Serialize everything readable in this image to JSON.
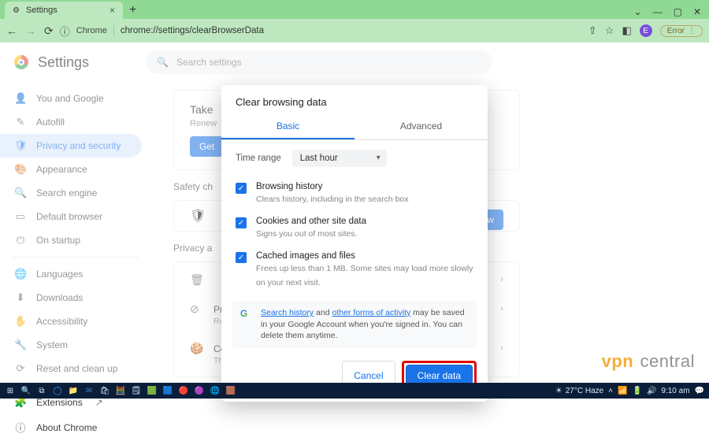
{
  "titlebar": {
    "tab_title": "Settings",
    "win_min": "—",
    "win_max": "▢",
    "win_close": "✕",
    "win_down": "⌄"
  },
  "urlbar": {
    "back": "←",
    "forward": "→",
    "reload": "⟳",
    "protocol_icon": "ⓘ",
    "chip": "Chrome",
    "url": "chrome://settings/clearBrowserData",
    "share": "⇧",
    "star": "☆",
    "ext": "◧",
    "avatar": "E",
    "error_label": "Error",
    "menu": "⋮"
  },
  "settings": {
    "title": "Settings",
    "search_placeholder": "Search settings",
    "sidebar": [
      {
        "icon": "👤",
        "label": "You and Google"
      },
      {
        "icon": "✎",
        "label": "Autofill"
      },
      {
        "icon": "🛡",
        "label": "Privacy and security"
      },
      {
        "icon": "🎨",
        "label": "Appearance"
      },
      {
        "icon": "🔍",
        "label": "Search engine"
      },
      {
        "icon": "▭",
        "label": "Default browser"
      },
      {
        "icon": "⏻",
        "label": "On startup"
      }
    ],
    "sidebar2": [
      {
        "icon": "🌐",
        "label": "Languages"
      },
      {
        "icon": "⬇",
        "label": "Downloads"
      },
      {
        "icon": "✋",
        "label": "Accessibility"
      },
      {
        "icon": "🔧",
        "label": "System"
      },
      {
        "icon": "⟳",
        "label": "Reset and clean up"
      }
    ],
    "sidebar3": [
      {
        "icon": "🧩",
        "label": "Extensions"
      },
      {
        "icon": "ⓘ",
        "label": "About Chrome"
      }
    ],
    "promo": {
      "title": "Take",
      "sub": "Renew",
      "cta": "Get"
    },
    "safety_label": "Safety ch",
    "safety_btn": "Check now",
    "privacy_label": "Privacy a",
    "rows": [
      {
        "icon": "🗑",
        "title": "",
        "sub": ""
      },
      {
        "icon": "⊘",
        "title": "Privacy guide",
        "sub": "Review key privacy and security controls"
      },
      {
        "icon": "🍪",
        "title": "Cookies and other site data",
        "sub": "Third-party cookies are blocked in Incognito mode"
      }
    ]
  },
  "modal": {
    "title": "Clear browsing data",
    "tab_basic": "Basic",
    "tab_advanced": "Advanced",
    "time_range_label": "Time range",
    "time_range_value": "Last hour",
    "checks": [
      {
        "title": "Browsing history",
        "sub": "Clears history, including in the search box"
      },
      {
        "title": "Cookies and other site data",
        "sub": "Signs you out of most sites."
      },
      {
        "title": "Cached images and files",
        "sub": "Frees up less than 1 MB. Some sites may load more slowly on your next visit."
      }
    ],
    "info_pre": "",
    "info_link1": "Search history",
    "info_mid": " and ",
    "info_link2": "other forms of activity",
    "info_post": " may be saved in your Google Account when you're signed in. You can delete them anytime.",
    "cancel": "Cancel",
    "clear": "Clear data"
  },
  "watermark": {
    "brand": "vpn",
    "dot": "•",
    "rest": "central"
  },
  "taskbar": {
    "weather": "27°C Haze",
    "time": "9:10 am",
    "icons": [
      "⊞",
      "🔍",
      "⧉",
      "◯",
      "📁",
      "✉",
      "🛍",
      "🧮",
      "🗒",
      "🟩",
      "🟦",
      "🔴",
      "🟣",
      "🌐",
      "🟫"
    ]
  }
}
